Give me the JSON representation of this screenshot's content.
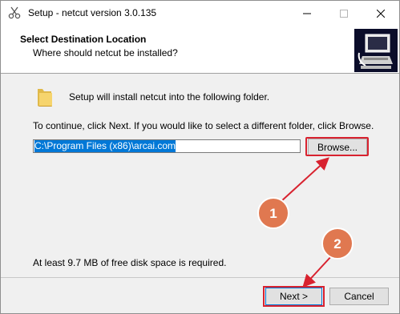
{
  "window": {
    "title": "Setup - netcut version 3.0.135"
  },
  "header": {
    "title": "Select Destination Location",
    "subtitle": "Where should netcut be installed?"
  },
  "body": {
    "intro": "Setup will install netcut into the following folder.",
    "instruction": "To continue, click Next. If you would like to select a different folder, click Browse.",
    "path_value": "C:\\Program Files (x86)\\arcai.com",
    "browse_label": "Browse...",
    "space_note": "At least 9.7 MB of free disk space is required."
  },
  "footer": {
    "next_label": "Next >",
    "cancel_label": "Cancel"
  },
  "annotations": {
    "badge_1": "1",
    "badge_2": "2",
    "color": "#d8222f",
    "badge_fill": "#e07850"
  }
}
